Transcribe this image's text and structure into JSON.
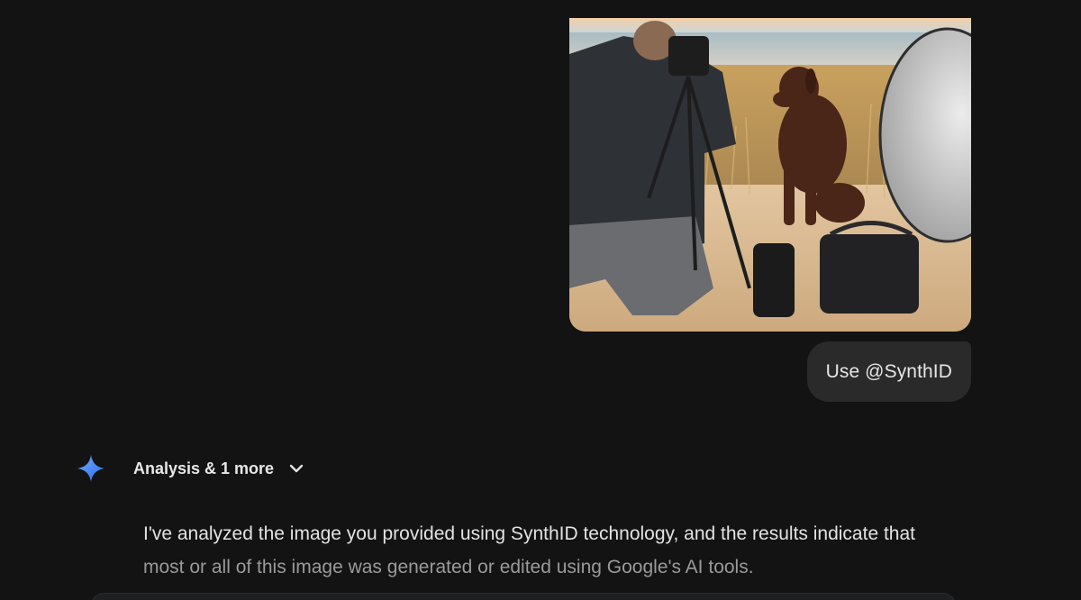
{
  "conversation": {
    "uploaded_image_alt": "Photographer with camera on tripod photographing a brown Labrador on a sandy beach at sunset, with a silver reflector",
    "user_prompt": "Use @SynthID"
  },
  "response": {
    "tools_label": "Analysis & 1 more",
    "text_line1": "I've analyzed the image you provided using SynthID technology, and the results indicate that",
    "text_line2": "most or all of this image was generated or edited using Google's AI tools."
  },
  "colors": {
    "background": "#131313",
    "bubble": "#2a2a2b",
    "gemini_blue": "#4b8df8"
  },
  "icons": {
    "assistant": "gemini-sparkle-icon",
    "expand": "chevron-down-icon"
  }
}
